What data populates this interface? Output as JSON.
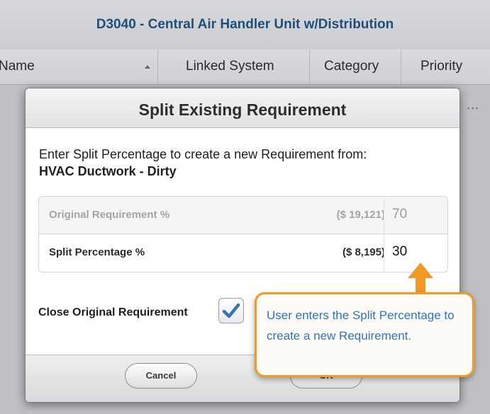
{
  "header": {
    "title": "D3040 - Central Air Handler Unit w/Distribution"
  },
  "columns": {
    "name": "Name",
    "linked_system": "Linked System",
    "category": "Category",
    "priority": "Priority"
  },
  "row_more": "...",
  "dialog": {
    "title": "Split Existing Requirement",
    "intro": "Enter Split Percentage to create a new Requirement from:",
    "requirement_name": "HVAC Ductwork - Dirty",
    "original": {
      "label": "Original Requirement %",
      "amount": "($ 19,121)",
      "percent": "70"
    },
    "split": {
      "label": "Split Percentage %",
      "amount": "($ 8,195)",
      "percent": "30"
    },
    "close_original_label": "Close Original Requirement",
    "close_original_checked": true,
    "cancel_label": "Cancel",
    "ok_label": "OK"
  },
  "callout": {
    "text": "User enters the Split Percentage to create a new Requirement."
  },
  "colors": {
    "accent": "#2f74c0",
    "callout_border": "#f29a26",
    "title_blue": "#1d4f7a"
  }
}
